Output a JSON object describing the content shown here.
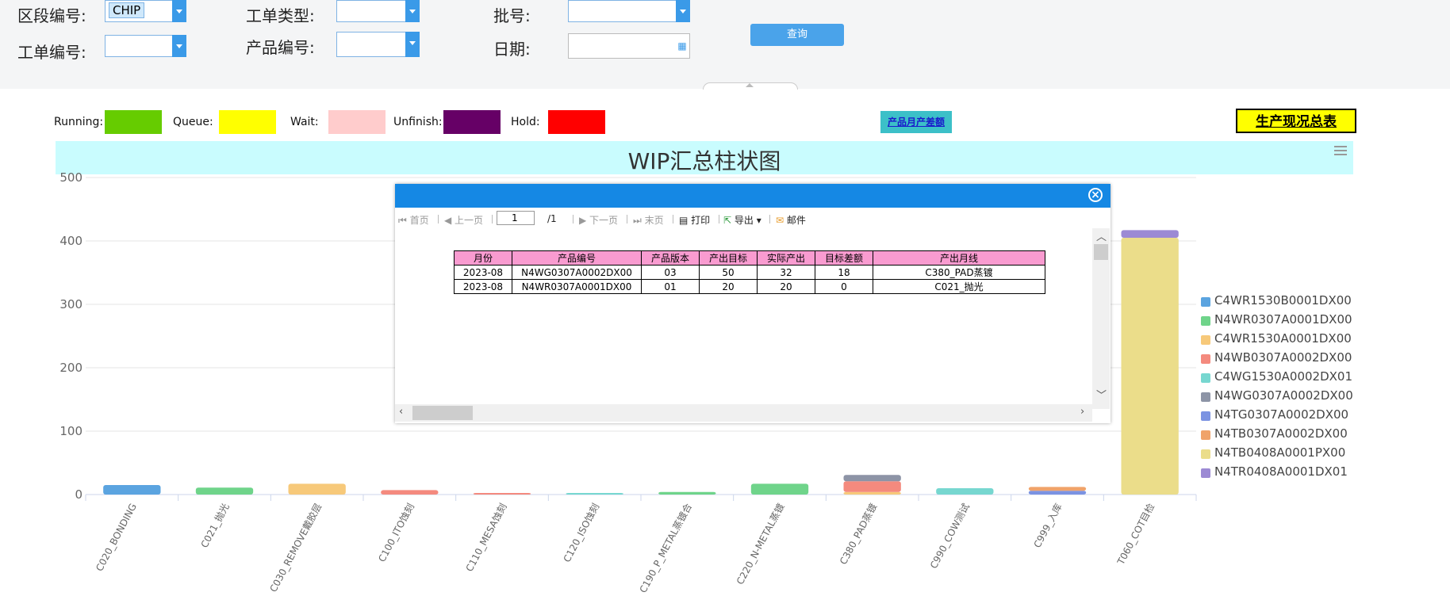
{
  "filters": {
    "section_label": "区段编号:",
    "section_value": "CHIP",
    "order_type_label": "工单类型:",
    "lot_label": "批号:",
    "order_no_label": "工单编号:",
    "product_label": "产品编号:",
    "date_label": "日期:",
    "query_button": "查询"
  },
  "status_legend": [
    {
      "label": "Running:",
      "color": "#66cc00"
    },
    {
      "label": "Queue:",
      "color": "#ffff00"
    },
    {
      "label": "Wait:",
      "color": "#ffcccc"
    },
    {
      "label": "Unfinish:",
      "color": "#660066"
    },
    {
      "label": "Hold:",
      "color": "#ff0000"
    }
  ],
  "buttons": {
    "monthly_diff": "产品月产差额",
    "production_summary": "生产现况总表"
  },
  "chart_data": {
    "type": "bar",
    "title": "WIP汇总柱状图",
    "ylim": [
      0,
      500
    ],
    "yticks": [
      0,
      100,
      200,
      300,
      400,
      500
    ],
    "categories": [
      "C020_BONDING",
      "C021_抛光",
      "C030_REMOVE戴胶层",
      "C100_ITO蚀刻",
      "C110_MESA蚀刻",
      "C120_ISO蚀刻",
      "C190_P_METAL蒸镀合",
      "C220_N-METAL蒸镀",
      "C380_PAD蒸镀",
      "C990_COW测试",
      "C999_入库",
      "T060_COT目检"
    ],
    "series": [
      {
        "name": "C4WR1530B0001DX00",
        "color": "#5ba4e0",
        "values": [
          15,
          0,
          0,
          0,
          0,
          0,
          0,
          0,
          0,
          0,
          0,
          0
        ]
      },
      {
        "name": "N4WR0307A0001DX00",
        "color": "#6fd48a",
        "values": [
          0,
          11,
          0,
          0,
          0,
          0,
          4,
          17,
          0,
          0,
          0,
          0
        ]
      },
      {
        "name": "C4WR1530A0001DX00",
        "color": "#f7c97a",
        "values": [
          0,
          0,
          17,
          0,
          0,
          0,
          0,
          0,
          4,
          0,
          0,
          0
        ]
      },
      {
        "name": "N4WB0307A0002DX00",
        "color": "#f48a7e",
        "values": [
          0,
          0,
          0,
          7,
          2,
          0,
          0,
          0,
          17,
          0,
          0,
          0
        ]
      },
      {
        "name": "C4WG1530A0002DX01",
        "color": "#77d7d0",
        "values": [
          0,
          0,
          0,
          0,
          0,
          1,
          0,
          0,
          0,
          10,
          0,
          0
        ]
      },
      {
        "name": "N4WG0307A0002DX00",
        "color": "#8d94a6",
        "values": [
          0,
          0,
          0,
          0,
          0,
          0,
          0,
          0,
          10,
          0,
          0,
          0
        ]
      },
      {
        "name": "N4TG0307A0002DX00",
        "color": "#7b93e2",
        "values": [
          0,
          0,
          0,
          0,
          0,
          0,
          0,
          0,
          0,
          0,
          6,
          0
        ]
      },
      {
        "name": "N4TB0307A0002DX00",
        "color": "#f0a36a",
        "values": [
          0,
          0,
          0,
          0,
          0,
          0,
          0,
          0,
          0,
          0,
          6,
          0
        ]
      },
      {
        "name": "N4TB0408A0001PX00",
        "color": "#ebdd8a",
        "values": [
          0,
          0,
          0,
          0,
          0,
          0,
          0,
          0,
          0,
          0,
          0,
          405
        ]
      },
      {
        "name": "N4TR0408A0001DX01",
        "color": "#9c8ad4",
        "values": [
          0,
          0,
          0,
          0,
          0,
          0,
          0,
          0,
          0,
          0,
          0,
          12
        ]
      }
    ]
  },
  "dialog": {
    "toolbar": {
      "first": "首页",
      "prev": "上一页",
      "page": "1",
      "total": "/1",
      "next": "下一页",
      "last": "末页",
      "print": "打印",
      "export": "导出",
      "mail": "邮件"
    },
    "table": {
      "headers": [
        "月份",
        "产品编号",
        "产品版本",
        "产出目标",
        "实际产出",
        "目标差额",
        "产出月线"
      ],
      "rows": [
        [
          "2023-08",
          "N4WG0307A0002DX00",
          "03",
          "50",
          "32",
          "18",
          "C380_PAD蒸镀"
        ],
        [
          "2023-08",
          "N4WR0307A0001DX00",
          "01",
          "20",
          "20",
          "0",
          "C021_抛光"
        ]
      ]
    }
  }
}
